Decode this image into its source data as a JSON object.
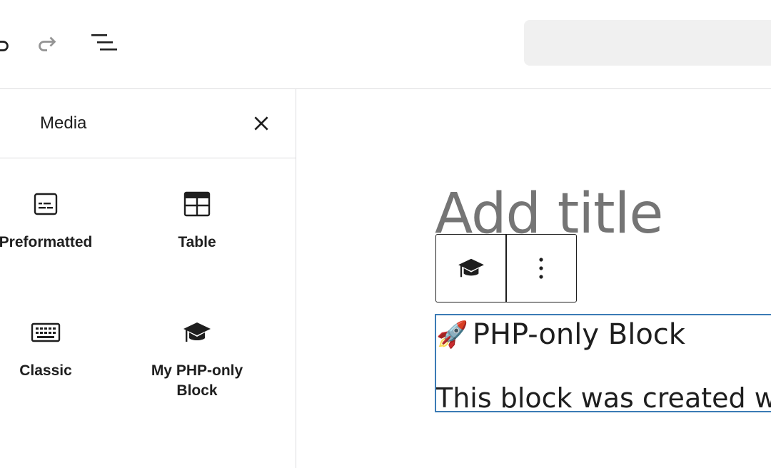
{
  "toolbar": {
    "undo_icon": "undo-icon",
    "redo_icon": "redo-icon",
    "document_overview_icon": "list-view-icon"
  },
  "inserter": {
    "tab_label": "Media",
    "close_icon": "close-icon",
    "blocks": [
      {
        "label": "Preformatted",
        "icon": "preformatted-icon"
      },
      {
        "label": "Table",
        "icon": "table-icon"
      },
      {
        "label": "Classic",
        "icon": "keyboard-icon"
      },
      {
        "label": "My PHP-only Block",
        "icon": "graduation-cap-icon"
      }
    ]
  },
  "editor": {
    "title_placeholder": "Add title",
    "block_toolbar": {
      "block_icon": "graduation-cap-icon",
      "options_icon": "more-vertical-icon"
    },
    "selected_block": {
      "heading": "PHP-only Block",
      "paragraph": "This block was created wit"
    }
  },
  "colors": {
    "selection_border": "#3b7bb5",
    "placeholder_text": "#757575"
  }
}
